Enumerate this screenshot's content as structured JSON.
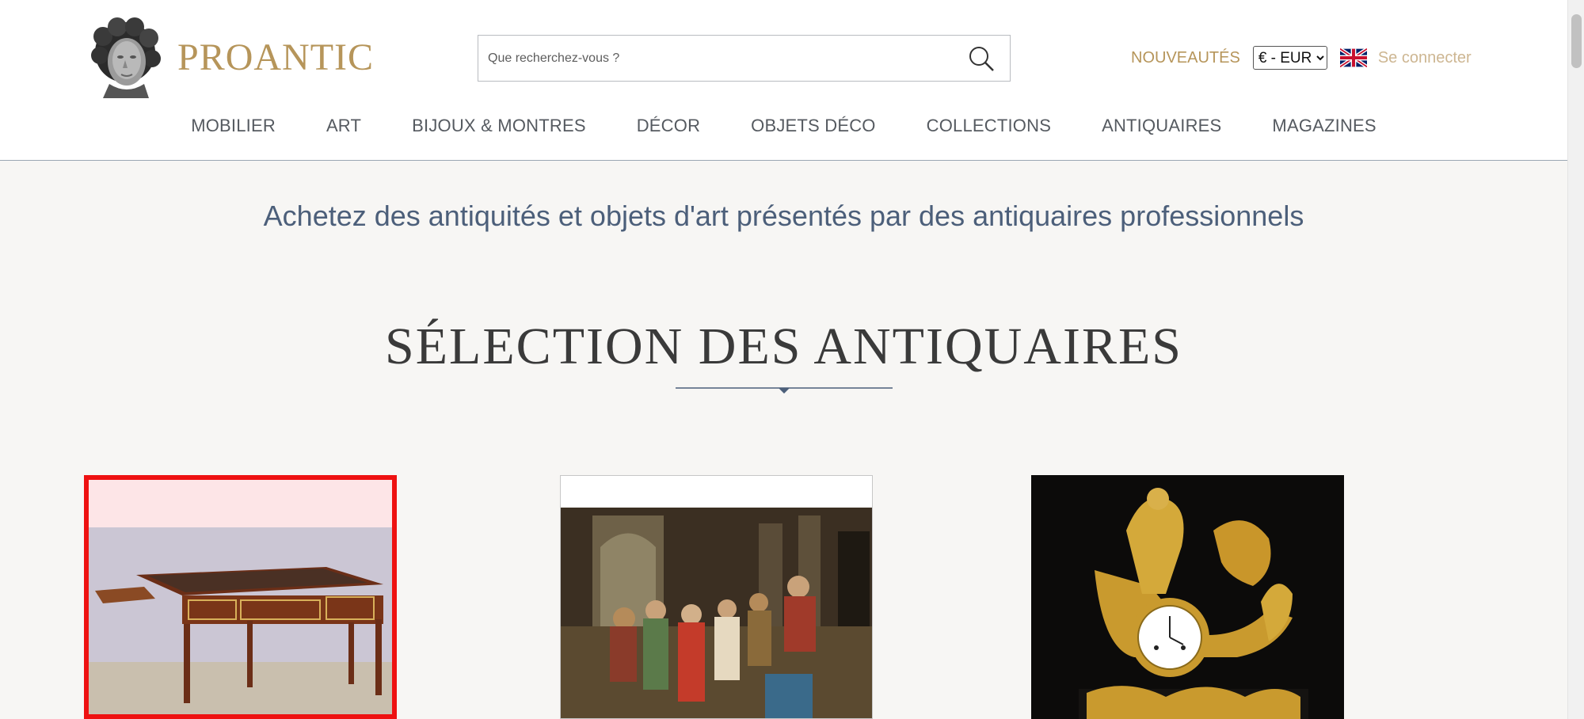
{
  "header": {
    "logo_text": "PROANTIC",
    "search_placeholder": "Que recherchez-vous ?",
    "nouveautes": "NOUVEAUTÉS",
    "currency_selected": "€ - EUR",
    "login": "Se connecter"
  },
  "nav": [
    {
      "label": "MOBILIER"
    },
    {
      "label": "ART"
    },
    {
      "label": "BIJOUX & MONTRES"
    },
    {
      "label": "DÉCOR"
    },
    {
      "label": "OBJETS DÉCO"
    },
    {
      "label": "COLLECTIONS"
    },
    {
      "label": "ANTIQUAIRES"
    },
    {
      "label": "MAGAZINES"
    }
  ],
  "main": {
    "tagline": "Achetez des antiquités et objets d'art présentés par des antiquaires professionnels",
    "section_title": "SÉLECTION DES ANTIQUAIRES"
  },
  "icons": {
    "logo": "classical-bust-icon",
    "search": "search-icon",
    "flag": "uk-flag-icon",
    "title_ornament": "diamond-divider-icon"
  },
  "colors": {
    "brand_gold": "#b6955a",
    "tagline_blue": "#4c5f7a",
    "selected_card_border": "#ee1111"
  }
}
